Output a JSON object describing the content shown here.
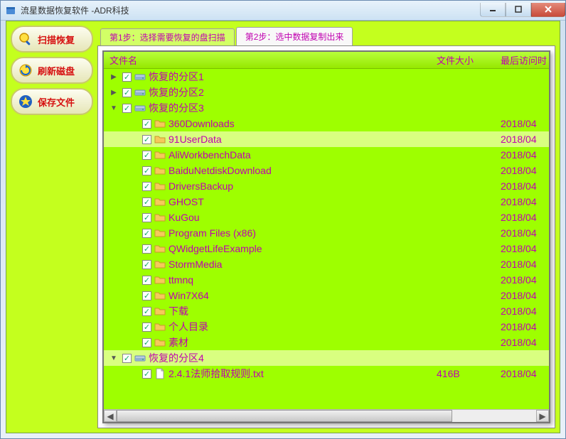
{
  "window": {
    "title": "流星数据恢复软件  -ADR科技"
  },
  "sidebar": {
    "buttons": [
      {
        "id": "scan-recover",
        "label": "扫描恢复"
      },
      {
        "id": "refresh-disk",
        "label": "刷新磁盘"
      },
      {
        "id": "save-file",
        "label": "保存文件"
      }
    ]
  },
  "tabs": [
    {
      "id": "step1",
      "label": "第1步：选择需要恢复的盘扫描",
      "active": false
    },
    {
      "id": "step2",
      "label": "第2步：选中数据复制出来",
      "active": true
    }
  ],
  "columns": {
    "name": "文件名",
    "size": "文件大小",
    "date": "最后访问时"
  },
  "tree": [
    {
      "depth": 0,
      "expander": "▶",
      "icon": "drive",
      "name": "恢复的分区1",
      "size": "",
      "date": ""
    },
    {
      "depth": 0,
      "expander": "▶",
      "icon": "drive",
      "name": "恢复的分区2",
      "size": "",
      "date": ""
    },
    {
      "depth": 0,
      "expander": "▼",
      "icon": "drive",
      "name": "恢复的分区3",
      "size": "",
      "date": ""
    },
    {
      "depth": 1,
      "expander": "",
      "icon": "folder",
      "name": "360Downloads",
      "size": "",
      "date": "2018/04"
    },
    {
      "depth": 1,
      "expander": "",
      "icon": "folder",
      "name": "91UserData",
      "size": "",
      "date": "2018/04",
      "highlight": true
    },
    {
      "depth": 1,
      "expander": "",
      "icon": "folder",
      "name": "AliWorkbenchData",
      "size": "",
      "date": "2018/04"
    },
    {
      "depth": 1,
      "expander": "",
      "icon": "folder",
      "name": "BaiduNetdiskDownload",
      "size": "",
      "date": "2018/04"
    },
    {
      "depth": 1,
      "expander": "",
      "icon": "folder",
      "name": "DriversBackup",
      "size": "",
      "date": "2018/04"
    },
    {
      "depth": 1,
      "expander": "",
      "icon": "folder",
      "name": "GHOST",
      "size": "",
      "date": "2018/04"
    },
    {
      "depth": 1,
      "expander": "",
      "icon": "folder",
      "name": "KuGou",
      "size": "",
      "date": "2018/04"
    },
    {
      "depth": 1,
      "expander": "",
      "icon": "folder",
      "name": "Program Files (x86)",
      "size": "",
      "date": "2018/04"
    },
    {
      "depth": 1,
      "expander": "",
      "icon": "folder",
      "name": "QWidgetLifeExample",
      "size": "",
      "date": "2018/04"
    },
    {
      "depth": 1,
      "expander": "",
      "icon": "folder",
      "name": "StormMedia",
      "size": "",
      "date": "2018/04"
    },
    {
      "depth": 1,
      "expander": "",
      "icon": "folder",
      "name": "ttmnq",
      "size": "",
      "date": "2018/04"
    },
    {
      "depth": 1,
      "expander": "",
      "icon": "folder",
      "name": "Win7X64",
      "size": "",
      "date": "2018/04"
    },
    {
      "depth": 1,
      "expander": "",
      "icon": "folder",
      "name": "下载",
      "size": "",
      "date": "2018/04"
    },
    {
      "depth": 1,
      "expander": "",
      "icon": "folder",
      "name": "个人目录",
      "size": "",
      "date": "2018/04"
    },
    {
      "depth": 1,
      "expander": "",
      "icon": "folder",
      "name": "素材",
      "size": "",
      "date": "2018/04"
    },
    {
      "depth": 0,
      "expander": "▼",
      "icon": "drive",
      "name": "恢复的分区4",
      "size": "",
      "date": "",
      "highlight": true
    },
    {
      "depth": 1,
      "expander": "",
      "icon": "file",
      "name": "2.4.1法师拾取规则.txt",
      "size": "416B",
      "date": "2018/04"
    }
  ]
}
